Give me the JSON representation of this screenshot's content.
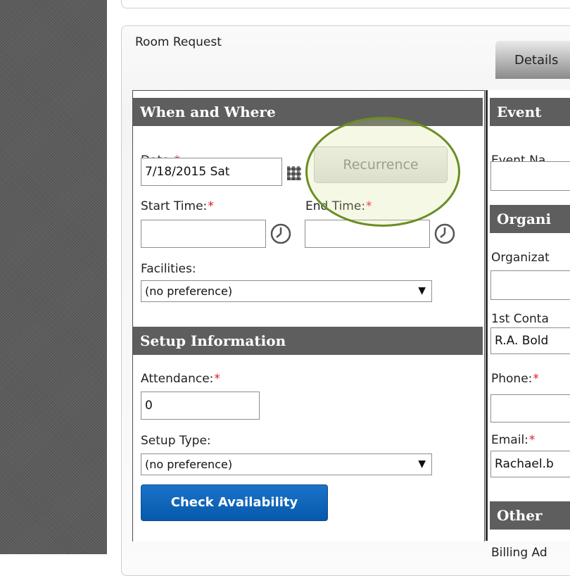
{
  "panel_title": "Room Request",
  "tabs": [
    {
      "label": "Details"
    }
  ],
  "when_where": {
    "header": "When and Where",
    "date_label": "Date:",
    "date_value": "7/18/2015 Sat",
    "recurrence_button": "Recurrence",
    "start_time_label": "Start Time:",
    "start_time_value": "",
    "end_time_label": "End Time:",
    "end_time_value": "",
    "facilities_label": "Facilities:",
    "facilities_value": "(no preference)"
  },
  "setup": {
    "header": "Setup Information",
    "attendance_label": "Attendance:",
    "attendance_value": "0",
    "setup_type_label": "Setup Type:",
    "setup_type_value": "(no preference)",
    "check_button": "Check Availability"
  },
  "event": {
    "header": "Event",
    "event_name_label": "Event Na",
    "event_name_value": ""
  },
  "organization": {
    "header": "Organi",
    "org_label": "Organizat",
    "org_value": "",
    "contact_label": "1st Conta",
    "contact_value": "R.A. Bold",
    "phone_label": "Phone:",
    "phone_value": "",
    "email_label": "Email:",
    "email_value": "Rachael.b"
  },
  "other": {
    "header": "Other",
    "billing_label": "Billing Ad"
  },
  "required_marker": "*",
  "dropdown_arrow": "▼",
  "colors": {
    "section_header_bg": "#5e5e5e",
    "primary_button": "#0b63b8",
    "required": "#e0192b",
    "highlight_ring": "#6a8e23"
  }
}
